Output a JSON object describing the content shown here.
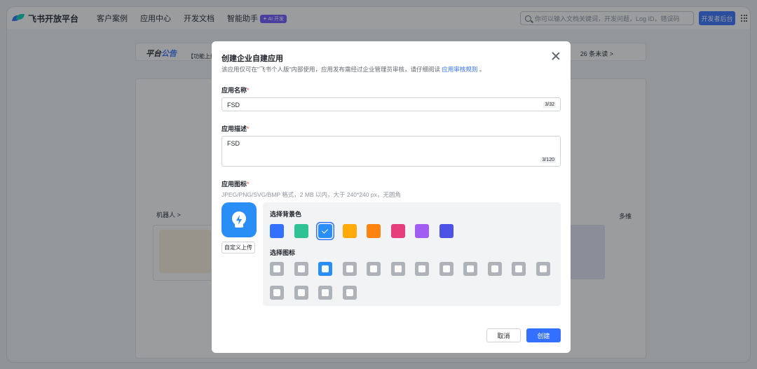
{
  "nav": {
    "logo": "飞书开放平台",
    "items": [
      "客户案例",
      "应用中心",
      "开发文档",
      "智能助手"
    ],
    "ai_badge": "✦ AI 开发",
    "search_placeholder": "你可以输入文档关键词，开发问题，Log ID，错误码",
    "dev_console": "开发者后台"
  },
  "background": {
    "notice_title_a": "平台",
    "notice_title_b": "公告",
    "notice_text": "【功能上线",
    "notice_unread": "26 条未读 >",
    "robot_section": "机器人 >",
    "right_section": "多维"
  },
  "modal": {
    "title": "创建企业自建应用",
    "desc": "该应用仅可在\"飞书个人版\"内部使用，应用发布需经过企业管理员审核，请仔细阅读",
    "desc_link": "应用审核规则",
    "desc_tail": "。",
    "name_label": "应用名称",
    "name_value": "FSD",
    "name_count": "3/32",
    "desc_label": "应用描述",
    "desc_value": "FSD",
    "desc_count": "3/120",
    "icon_label": "应用图标",
    "icon_hint": "JPEG/PNG/SVG/BMP 格式，2 MB 以内，大于 240*240 px，无圆角",
    "upload_label": "自定义上传",
    "bg_label": "选择背景色",
    "bg_colors": [
      "#3370ff",
      "#2ec294",
      "#2a8ef7",
      "#ffaa0a",
      "#ff8311",
      "#e63d7b",
      "#a15cf2",
      "#4c52e6"
    ],
    "selected_bg": 2,
    "icon_select_label": "选择图标",
    "icon_names": [
      "cube-icon",
      "robot-icon",
      "lightbulb-icon",
      "chart-icon",
      "briefcase-icon",
      "bell-icon",
      "checklist-icon",
      "moon-icon",
      "star-icon",
      "tag-icon",
      "wrench-icon",
      "document-icon",
      "shield-check-icon",
      "layout-icon",
      "people-icon",
      "code-icon"
    ],
    "selected_icon": 2,
    "required_mark": "*",
    "cancel": "取消",
    "create": "创建"
  }
}
